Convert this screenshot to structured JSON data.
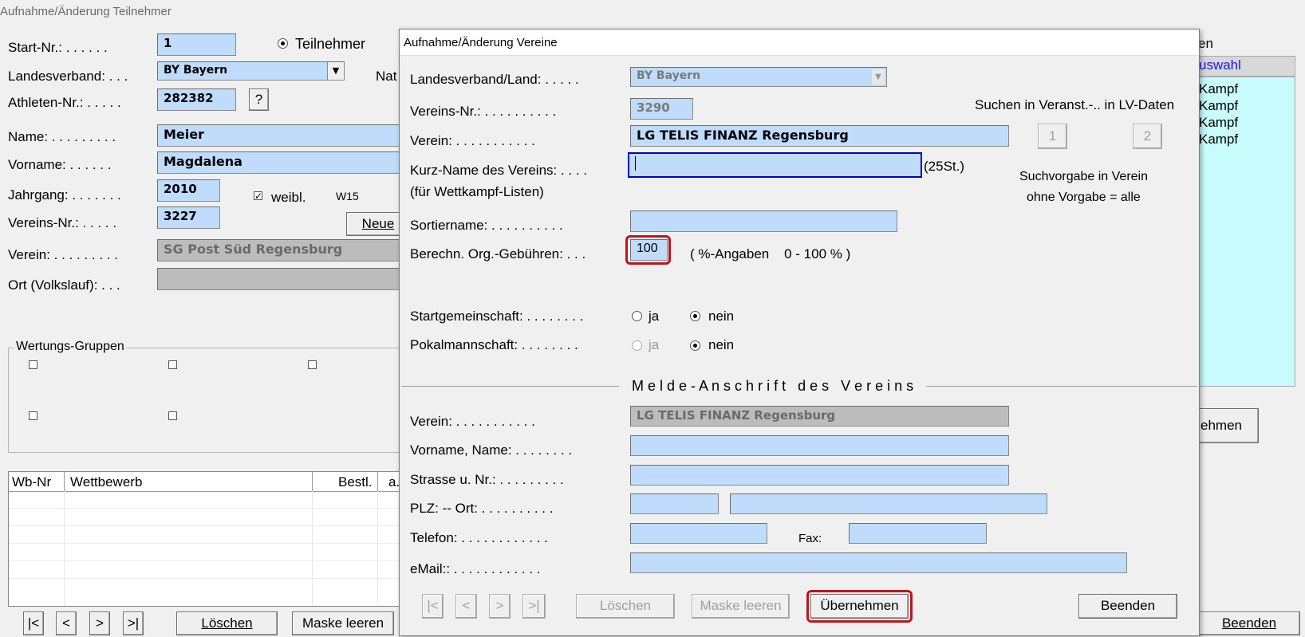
{
  "main": {
    "title": "Aufnahme/Änderung Teilnehmer",
    "labels": {
      "start_nr": "Start-Nr.: . . . . . .",
      "landesverband": "Landesverband: . . .",
      "athleten_nr": "Athleten-Nr.: . . . . .",
      "name": "Name: . . . . . . . . .",
      "vorname": "Vorname: . . . . . .",
      "jahrgang": "Jahrgang: . . . . . . .",
      "vereins_nr": "Vereins-Nr.: . . . . .",
      "verein": "Verein: . . . . . . . . .",
      "ort": "Ort (Volkslauf): . . .",
      "nat": "Nat"
    },
    "values": {
      "start_nr": "1",
      "landesverband": "BY Bayern",
      "athleten_nr": "282382",
      "name": "Meier",
      "vorname": "Magdalena",
      "jahrgang": "2010",
      "vereins_nr": "3227",
      "verein": "SG Post Süd Regensburg",
      "ort": ""
    },
    "teilnehmer_radio": "Teilnehmer",
    "help_button": "?",
    "weibl_checkbox": "weibl.",
    "age_class": "W15",
    "neue_button": "Neue",
    "wertungs_gruppen": "Wertungs-Gruppen",
    "table_headers": [
      "Wb-Nr",
      "Wettbewerb",
      "Bestl.",
      "a."
    ],
    "nav_buttons": [
      "|<",
      "<",
      ">",
      ">|"
    ],
    "loeschen_button": "Löschen",
    "maske_leeren_button": "Maske leeren",
    "right_header_fragment": "en",
    "right_auswahl": "uswahl",
    "right_list": [
      "Kampf",
      "Kampf",
      "Kampf",
      "Kampf"
    ],
    "uebernehmen_fragment": "ehmen",
    "beenden_button": "Beenden"
  },
  "dialog": {
    "title": "Aufnahme/Änderung Vereine",
    "labels": {
      "landesverband_land": "Landesverband/Land: . . . . .",
      "vereins_nr": "Vereins-Nr.: . . . . . . . . . .",
      "verein": "Verein: . . . . . . . . . . .",
      "kurz_name": "Kurz-Name des Vereins: . . . .",
      "kurz_name_sub": "(für Wettkampf-Listen)",
      "sortiername": "Sortiername: . . . . . . . . . .",
      "org_gebuehren": "Berechn. Org.-Gebühren: . . .",
      "startgemeinschaft": "Startgemeinschaft: . . . . . . . .",
      "pokalmannschaft": "Pokalmannschaft: . . . . . . . .",
      "melde_verein": "Verein: . . . . . . . . . . .",
      "vorname_name": "Vorname, Name: . . . . . . . .",
      "strasse": "Strasse u. Nr.: . . . . . . . . .",
      "plz_ort": "PLZ: -- Ort: . . . . . . . . . .",
      "telefon": "Telefon: . . . . . . . . . . . .",
      "fax": "Fax:",
      "email": "eMail:: . . . . . . . . . . . ."
    },
    "values": {
      "landesverband_land": "BY Bayern",
      "vereins_nr": "3290",
      "verein": "LG TELIS FINANZ Regensburg",
      "kurz_name": "",
      "sortiername": "",
      "org_gebuehren": "100",
      "melde_verein": "LG TELIS FINANZ Regensburg",
      "vorname_name": "",
      "strasse": "",
      "plz": "",
      "ort": "",
      "telefon": "",
      "fax": "",
      "email": ""
    },
    "kurz_name_hint": "(25St.)",
    "prozent_hint": "( %-Angaben    0 - 100 % )",
    "radio_ja": "ja",
    "radio_nein": "nein",
    "suchen_label": "Suchen in Veranst.-.. in LV-Daten",
    "suchen_btn1": "1",
    "suchen_btn2": "2",
    "suchvorgabe_line1": "Suchvorgabe in Verein",
    "suchvorgabe_line2": "ohne Vorgabe  =  alle",
    "section_title": "M e l d e - A n s c h r i f t   d e s   V e r e i n s",
    "nav_buttons": [
      "|<",
      "<",
      ">",
      ">|"
    ],
    "loeschen_button": "Löschen",
    "maske_leeren_button": "Maske leeren",
    "uebernehmen_button": "Übernehmen",
    "beenden_button": "Beenden"
  },
  "colors": {
    "field_blue": "#bfdcfc",
    "highlight_red": "#c0131b",
    "focus_border": "#0000cc",
    "list_cyan": "#c8fcfc"
  }
}
